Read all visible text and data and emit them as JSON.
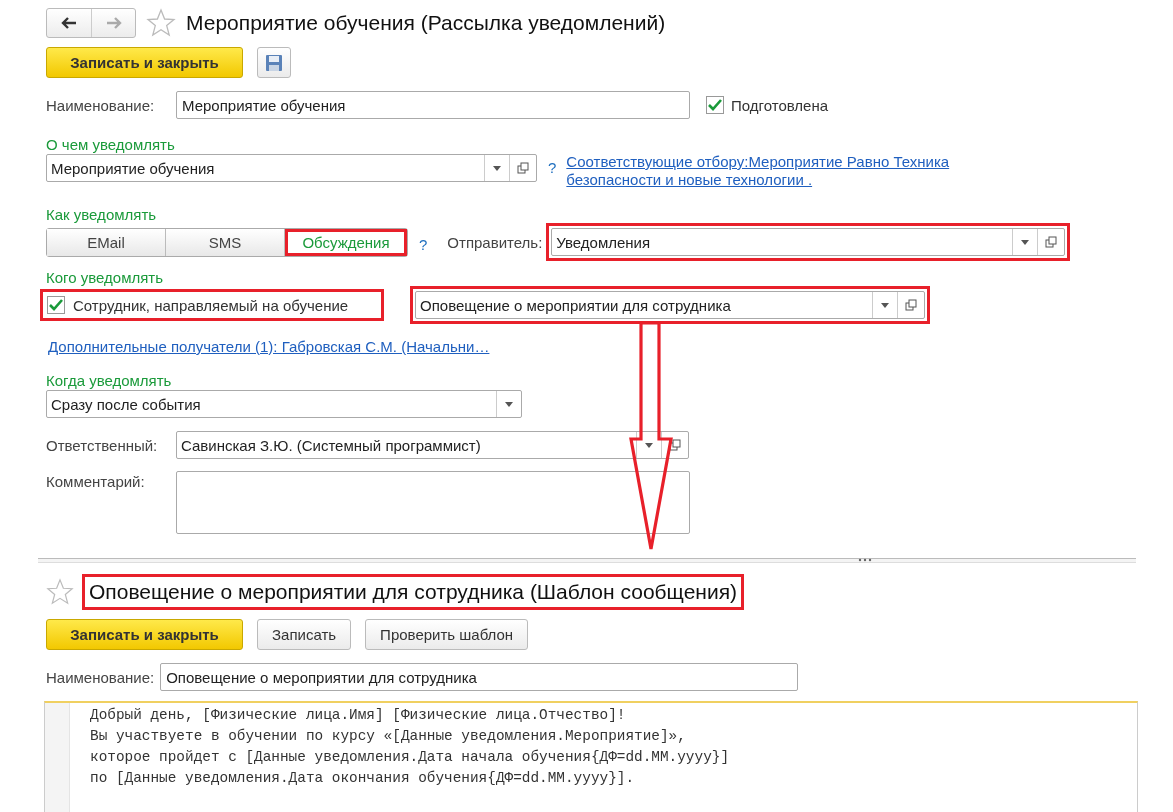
{
  "nav": {
    "back_enabled": true,
    "forward_enabled": false
  },
  "form": {
    "title": "Мероприятие обучения (Рассылка уведомлений)",
    "favorite": false,
    "save_close": "Записать и закрыть",
    "name_label": "Наименование:",
    "name_value": "Мероприятие обучения",
    "prepared": {
      "label": "Подготовлена",
      "checked": true
    },
    "what_label": "О чем уведомлять",
    "what_value": "Мероприятие обучения",
    "what_help": "?",
    "what_link": "Соответствующие отбору:Мероприятие Равно Техника безопасности и новые технологии .",
    "how_label": "Как уведомлять",
    "channels": [
      {
        "label": "EMail",
        "selected": false,
        "highlighted": false
      },
      {
        "label": "SMS",
        "selected": false,
        "highlighted": false
      },
      {
        "label": "Обсуждения",
        "selected": true,
        "highlighted": true
      }
    ],
    "how_help": "?",
    "sender_label": "Отправитель:",
    "sender_value": "Уведомления",
    "sender_highlighted": true,
    "whom_label": "Кого уведомлять",
    "employee": {
      "label": "Сотрудник, направляемый на обучение",
      "checked": true,
      "highlighted": true
    },
    "template_value": "Оповещение о мероприятии для сотрудника",
    "template_highlighted": true,
    "extra_link": "Дополнительные получатели (1): Габровская С.М. (Начальни…",
    "when_label": "Когда уведомлять",
    "when_value": "Сразу после события",
    "resp_label": "Ответственный:",
    "resp_value": "Савинская З.Ю. (Системный программист)",
    "comment_label": "Комментарий:"
  },
  "template": {
    "title": "Оповещение о мероприятии для сотрудника (Шаблон сообщения)",
    "title_highlighted": true,
    "favorite": false,
    "buttons": [
      {
        "label": "Записать и закрыть",
        "kind": "primary"
      },
      {
        "label": "Записать",
        "kind": "plain"
      },
      {
        "label": "Проверить шаблон",
        "kind": "plain"
      }
    ],
    "name_label": "Наименование:",
    "name_value": "Оповещение о мероприятии для сотрудника",
    "lines": [
      "Добрый день, [Физические лица.Имя] [Физические лица.Отчество]!",
      "Вы участвуете в обучении по курсу «[Данные уведомления.Мероприятие]»,",
      "которое пройдет с [Данные уведомления.Дата начала обучения{ДФ=dd.MM.yyyy}]",
      "по [Данные уведомления.Дата окончания обучения{ДФ=dd.MM.yyyy}]."
    ]
  },
  "annotation_arrow": true
}
